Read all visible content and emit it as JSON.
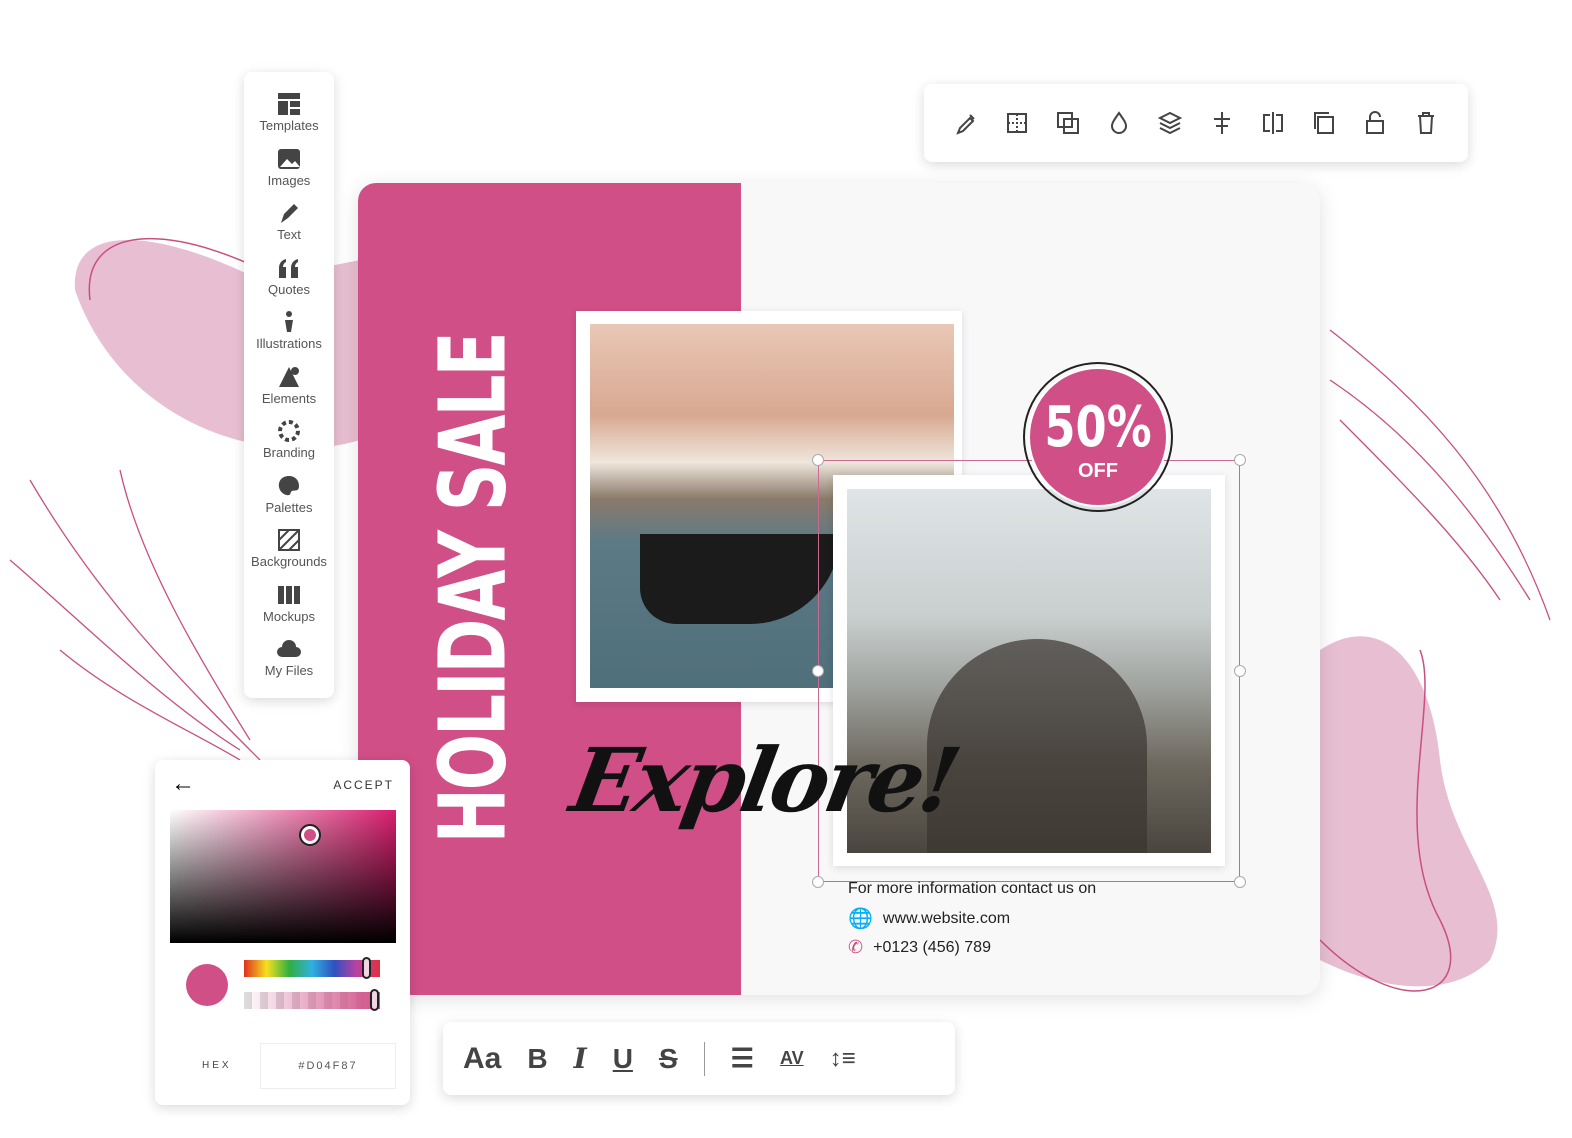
{
  "sidebar": {
    "items": [
      {
        "label": "Templates",
        "icon": "templates-icon"
      },
      {
        "label": "Images",
        "icon": "images-icon"
      },
      {
        "label": "Text",
        "icon": "pen-icon"
      },
      {
        "label": "Quotes",
        "icon": "quotes-icon"
      },
      {
        "label": "Illustrations",
        "icon": "illustrations-icon"
      },
      {
        "label": "Elements",
        "icon": "elements-icon"
      },
      {
        "label": "Branding",
        "icon": "gear-icon"
      },
      {
        "label": "Palettes",
        "icon": "palette-icon"
      },
      {
        "label": "Backgrounds",
        "icon": "backgrounds-icon"
      },
      {
        "label": "Mockups",
        "icon": "mockups-icon"
      },
      {
        "label": "My Files",
        "icon": "cloud-icon"
      }
    ]
  },
  "toolbar": {
    "icons": [
      "eyedropper-icon",
      "grid-icon",
      "arrange-icon",
      "opacity-icon",
      "layers-icon",
      "align-center-icon",
      "flip-icon",
      "duplicate-icon",
      "lock-icon",
      "trash-icon"
    ]
  },
  "design": {
    "headline": "HOLIDAY SALE",
    "script": "Explore!",
    "badge_value": "50%",
    "badge_label": "OFF",
    "contact_intro": "For more information contact us on",
    "website": "www.website.com",
    "phone": "+0123 (456) 789"
  },
  "picker": {
    "accept": "ACCEPT",
    "hex_label": "HEX",
    "hex_value": "#D04F87",
    "hue_position": 0.9,
    "alpha": 1.0
  },
  "text_toolbar": {
    "font_label": "Aa",
    "bold": "B",
    "italic": "I",
    "underline": "U",
    "strike": "S",
    "spacing_label": "AV"
  },
  "colors": {
    "brand": "#D04F87",
    "pale": "#E8BFD2"
  }
}
